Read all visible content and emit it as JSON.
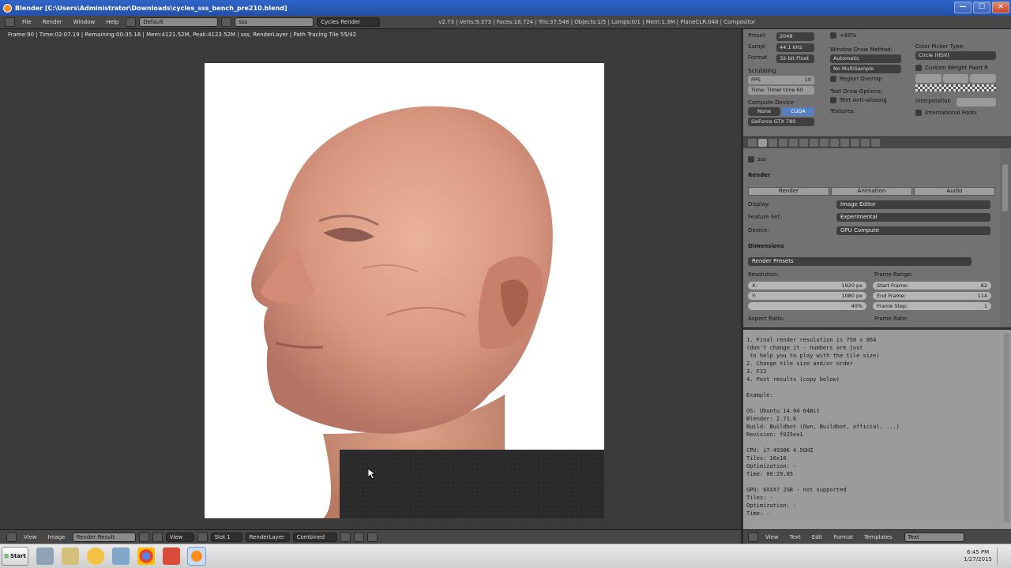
{
  "window": {
    "title": "Blender  [C:\\Users\\Administrator\\Downloads\\cycles_sss_bench_pre210.blend]",
    "min": "—",
    "max": "☐",
    "close": "✕"
  },
  "infobar": {
    "menus": [
      "File",
      "Render",
      "Window",
      "Help"
    ],
    "screen_layout": "Default",
    "scene": "sss",
    "engine": "Cycles Render",
    "stats": "v2.73 | Verts:9,373 | Faces:18,724 | Tris:37,548 | Objects:1/5 | Lamps:0/1 | Mem:1.3M | PlaneCLR.048 | Compositor"
  },
  "image_editor": {
    "render_status": "Frame:90 | Time:02:07.19 | Remaining:00:35.16 | Mem:4121.52M, Peak:4123.52M | sss, RenderLayer | Path Tracing Tile 55/42",
    "footer": {
      "menus": [
        "View",
        "Image"
      ],
      "image_name": "Render Result",
      "view_label": "View",
      "slot": "Slot 1",
      "layer": "RenderLayer",
      "pass": "Combined"
    }
  },
  "properties_top": {
    "preset_label": "Preset",
    "preset_value": "2048",
    "sample_label": "Sampl",
    "sample_value": "44.1 kHz",
    "format_label": "Format",
    "format_value": "32-bit Float",
    "scrubbing_label": "Scrubbing",
    "fps_value": "FPS",
    "fps_num": "10",
    "time_value": "Time: Timer time 60",
    "compute_device_label": "Compute Device",
    "device_none": "None",
    "device_cuda": "CUDA",
    "device_gpu": "GeForce GTX 780",
    "percent_label": "+80%",
    "window_draw_label": "Window Draw Method:",
    "window_draw_value": "Automatic",
    "multisample_value": "No MultiSample",
    "region_overlap": "Region Overlap",
    "text_draw_label": "Text Draw Options:",
    "text_antialias": "Text Anti-aliasing",
    "textures_label": "Textures:",
    "color_picker_label": "Color Picker Type:",
    "color_picker_value": "Circle (HSV)",
    "custom_weight": "Custom Weight Paint R",
    "interpolation_label": "Interpolation",
    "international_fonts": "International Fonts",
    "translate": "Translate"
  },
  "properties": {
    "camera_row": "sss",
    "render_section": "Render",
    "render_btn": "Render",
    "animation_btn": "Animation",
    "audio_btn": "Audio",
    "display_label": "Display:",
    "display_value": "Image Editor",
    "feature_set_label": "Feature Set:",
    "feature_set_value": "Experimental",
    "device_label": "Device:",
    "device_value": "GPU Compute",
    "dimensions_section": "Dimensions",
    "render_presets": "Render Presets",
    "resolution_label": "Resolution:",
    "res_x_label": "X:",
    "res_x_value": "1920 px",
    "res_y_label": "Y:",
    "res_y_value": "1080 px",
    "res_pct": "40%",
    "frame_range_label": "Frame Range:",
    "start_label": "Start Frame:",
    "start_value": "62",
    "end_label": "End Frame:",
    "end_value": "114",
    "step_label": "Frame Step:",
    "step_value": "1",
    "aspect_label": "Aspect Ratio:",
    "frame_rate_label": "Frame Rate:"
  },
  "text_editor": {
    "lines": [
      "1. Final render resolution is 750 x 864",
      "(don't change it - numbers are just",
      " to help you to play with the tile size)",
      "2. Change tile size and/or order",
      "3. F12",
      "4. Post results (copy below)",
      "",
      "Example:",
      "",
      "OS: Ubuntu 14.04 64Bit",
      "Blender: 2.71.6",
      "Build: Buildbot (Own, Buildbot, official, ...)",
      "Revision: f025ea1",
      "",
      "CPU: i7-4930K 4.5GHZ",
      "Tiles: 16x16",
      "Optimization: -",
      "Time: 00:29.85",
      "",
      "GPU: 6XXX? 2GB - not supported",
      "Tiles: -",
      "Optimization: -",
      "Time: -"
    ],
    "footer": {
      "menus": [
        "View",
        "Text",
        "Edit",
        "Format",
        "Templates"
      ],
      "text_name": "Text"
    }
  },
  "taskbar": {
    "start_label": "Start",
    "time": "6:45 PM",
    "date": "1/27/2015"
  },
  "colors": {
    "title_bar": "#2d5fc2",
    "blender_orange": "#ff8c1a",
    "selected_blue": "#5680c2"
  }
}
